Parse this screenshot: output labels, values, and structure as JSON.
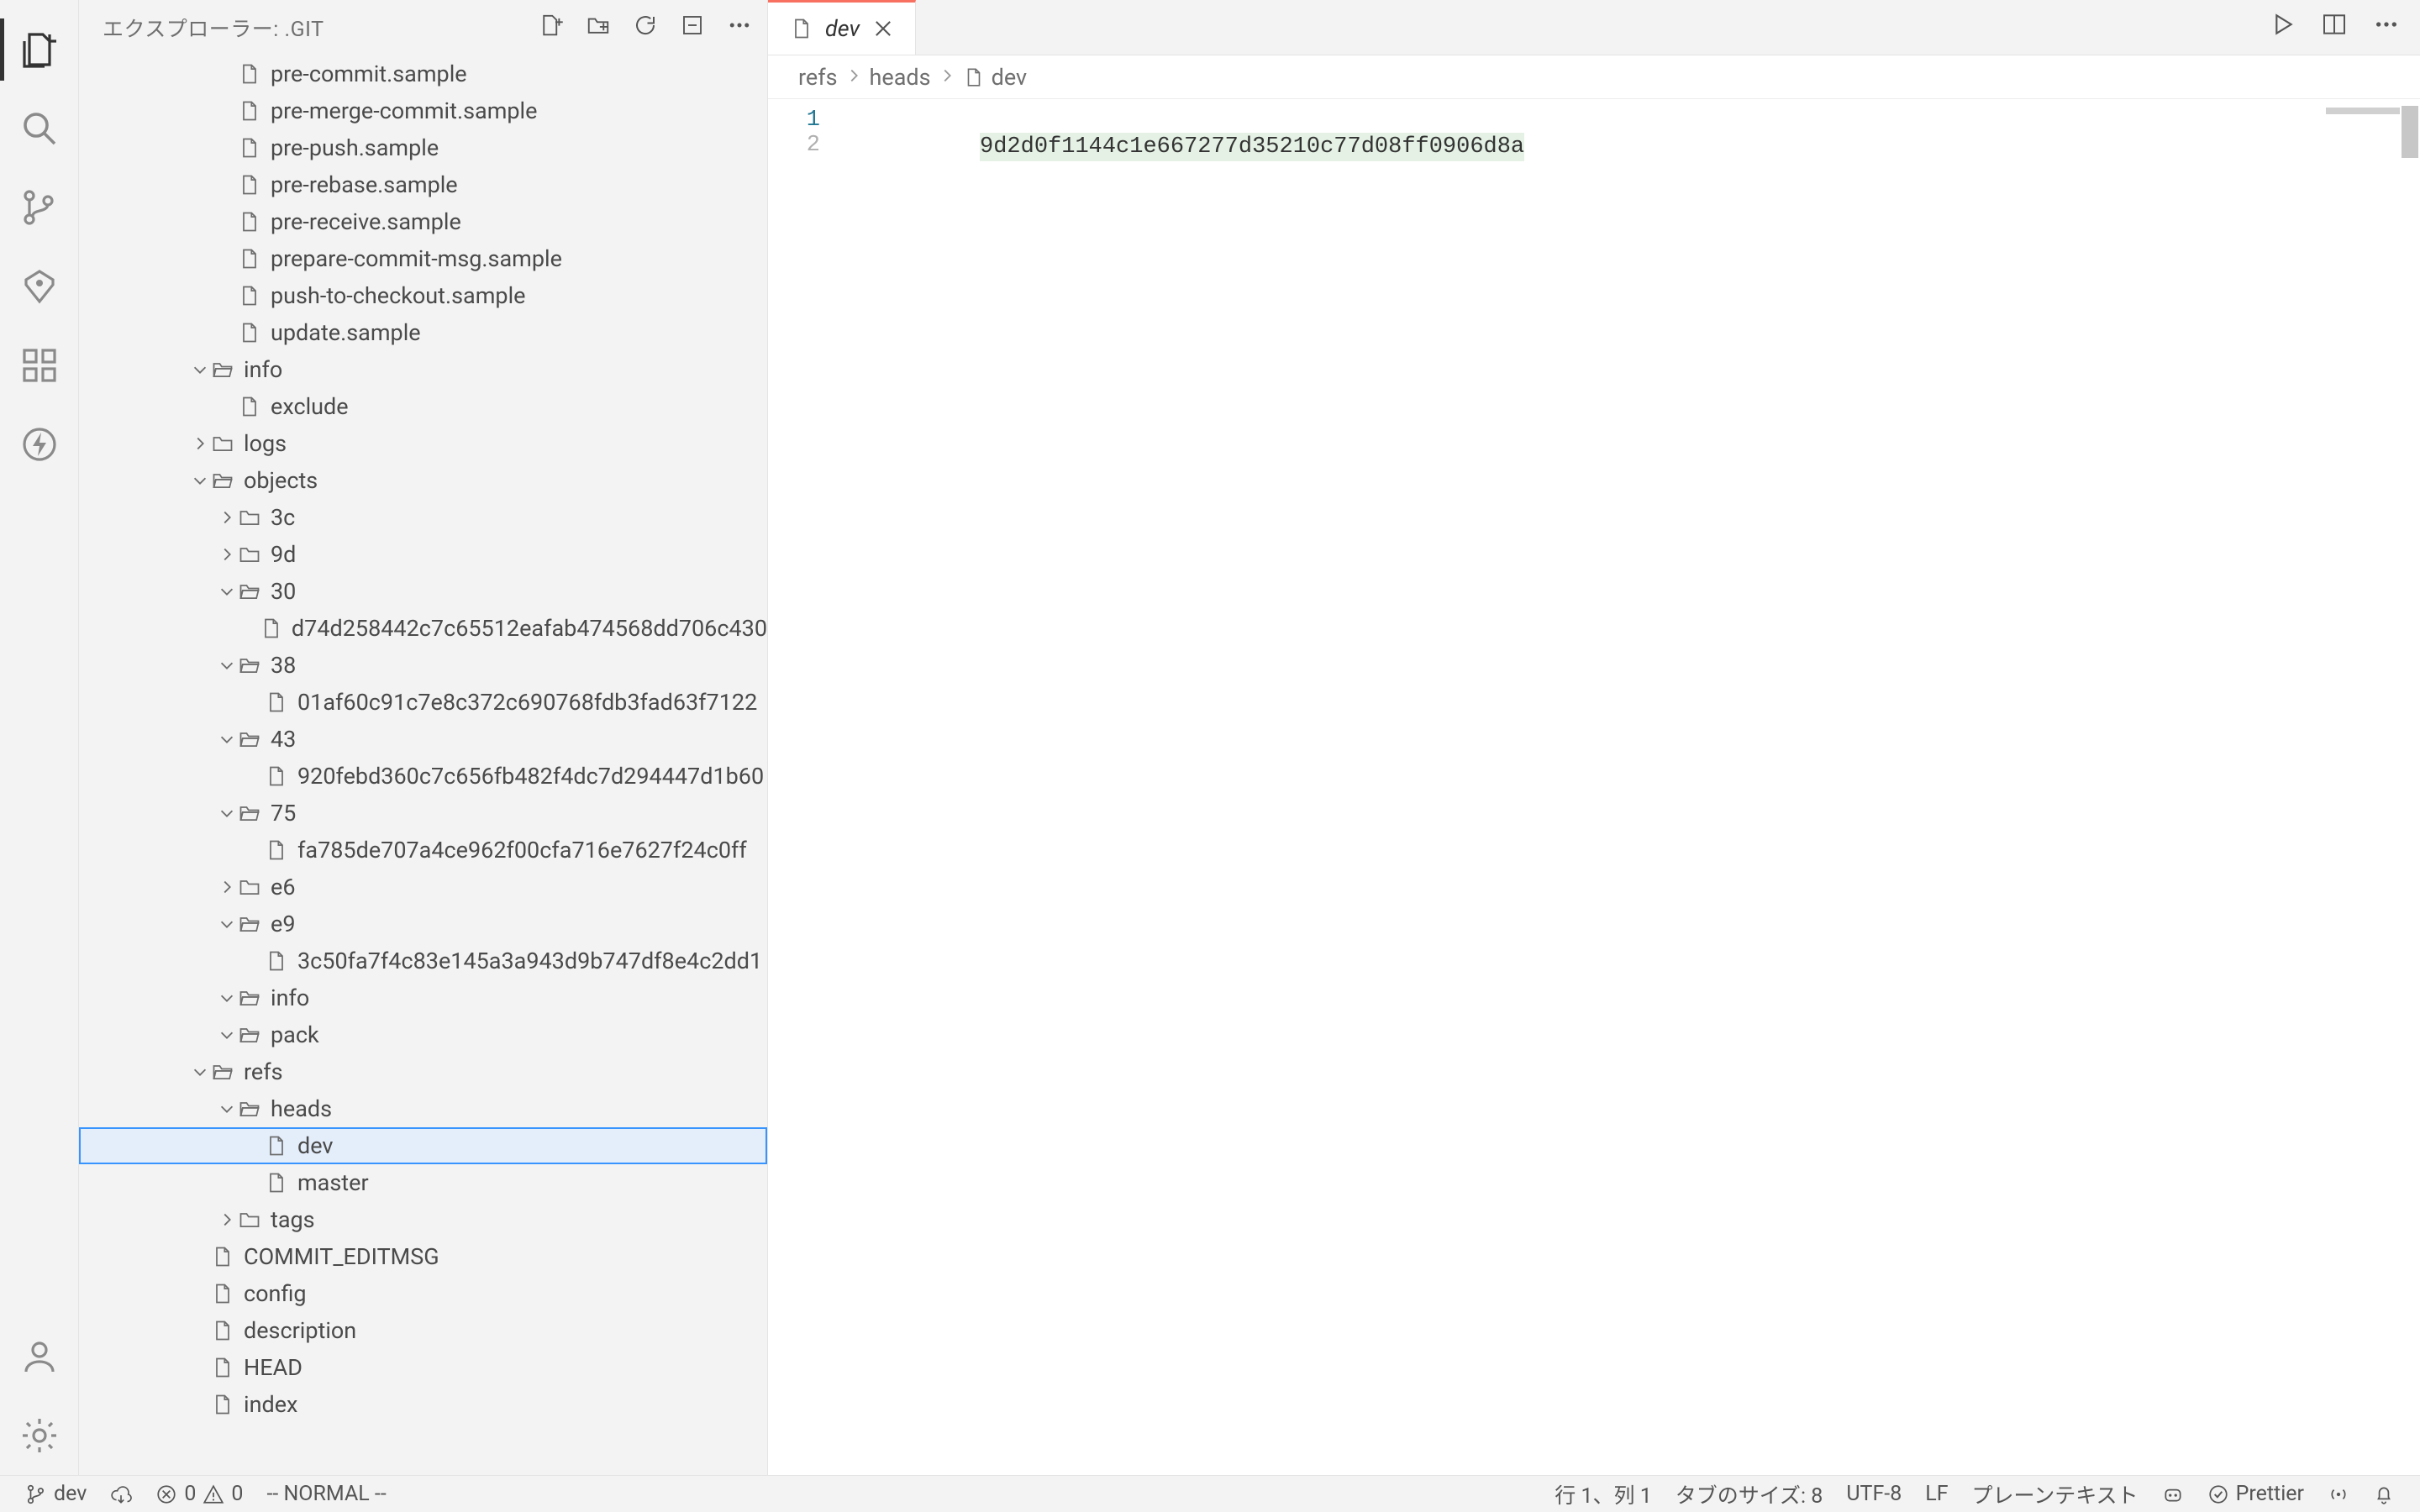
{
  "sidebar": {
    "title": "エクスプローラー: .GIT"
  },
  "tree": [
    {
      "d": 3,
      "k": "file",
      "label": "pre-commit.sample"
    },
    {
      "d": 3,
      "k": "file",
      "label": "pre-merge-commit.sample"
    },
    {
      "d": 3,
      "k": "file",
      "label": "pre-push.sample"
    },
    {
      "d": 3,
      "k": "file",
      "label": "pre-rebase.sample"
    },
    {
      "d": 3,
      "k": "file",
      "label": "pre-receive.sample"
    },
    {
      "d": 3,
      "k": "file",
      "label": "prepare-commit-msg.sample"
    },
    {
      "d": 3,
      "k": "file",
      "label": "push-to-checkout.sample"
    },
    {
      "d": 3,
      "k": "file",
      "label": "update.sample"
    },
    {
      "d": 2,
      "k": "folder-open",
      "label": "info"
    },
    {
      "d": 3,
      "k": "file",
      "label": "exclude"
    },
    {
      "d": 2,
      "k": "folder",
      "label": "logs"
    },
    {
      "d": 2,
      "k": "folder-open",
      "label": "objects"
    },
    {
      "d": 3,
      "k": "folder",
      "label": "3c"
    },
    {
      "d": 3,
      "k": "folder",
      "label": "9d"
    },
    {
      "d": 3,
      "k": "folder-open",
      "label": "30"
    },
    {
      "d": 4,
      "k": "file",
      "label": "d74d258442c7c65512eafab474568dd706c430"
    },
    {
      "d": 3,
      "k": "folder-open",
      "label": "38"
    },
    {
      "d": 4,
      "k": "file",
      "label": "01af60c91c7e8c372c690768fdb3fad63f7122"
    },
    {
      "d": 3,
      "k": "folder-open",
      "label": "43"
    },
    {
      "d": 4,
      "k": "file",
      "label": "920febd360c7c656fb482f4dc7d294447d1b60"
    },
    {
      "d": 3,
      "k": "folder-open",
      "label": "75"
    },
    {
      "d": 4,
      "k": "file",
      "label": "fa785de707a4ce962f00cfa716e7627f24c0ff"
    },
    {
      "d": 3,
      "k": "folder",
      "label": "e6"
    },
    {
      "d": 3,
      "k": "folder-open",
      "label": "e9"
    },
    {
      "d": 4,
      "k": "file",
      "label": "3c50fa7f4c83e145a3a943d9b747df8e4c2dd1"
    },
    {
      "d": 3,
      "k": "folder-open",
      "label": "info"
    },
    {
      "d": 3,
      "k": "folder-open",
      "label": "pack"
    },
    {
      "d": 2,
      "k": "folder-open",
      "label": "refs"
    },
    {
      "d": 3,
      "k": "folder-open",
      "label": "heads"
    },
    {
      "d": 4,
      "k": "file",
      "label": "dev",
      "selected": true
    },
    {
      "d": 4,
      "k": "file",
      "label": "master"
    },
    {
      "d": 3,
      "k": "folder",
      "label": "tags"
    },
    {
      "d": 2,
      "k": "file",
      "label": "COMMIT_EDITMSG"
    },
    {
      "d": 2,
      "k": "file",
      "label": "config"
    },
    {
      "d": 2,
      "k": "file",
      "label": "description"
    },
    {
      "d": 2,
      "k": "file",
      "label": "HEAD"
    },
    {
      "d": 2,
      "k": "file",
      "label": "index"
    }
  ],
  "tab": {
    "label": "dev"
  },
  "breadcrumbs": [
    "refs",
    "heads",
    "dev"
  ],
  "editor": {
    "line1_no": "1",
    "line2_no": "2",
    "content": "9d2d0f1144c1e667277d35210c77d08ff0906d8a"
  },
  "status": {
    "branch": "dev",
    "errors": "0",
    "warnings": "0",
    "vim_mode": "-- NORMAL --",
    "position": "行 1、列 1",
    "spaces": "タブのサイズ: 8",
    "encoding": "UTF-8",
    "eol": "LF",
    "lang": "プレーンテキスト",
    "prettier": "Prettier"
  }
}
